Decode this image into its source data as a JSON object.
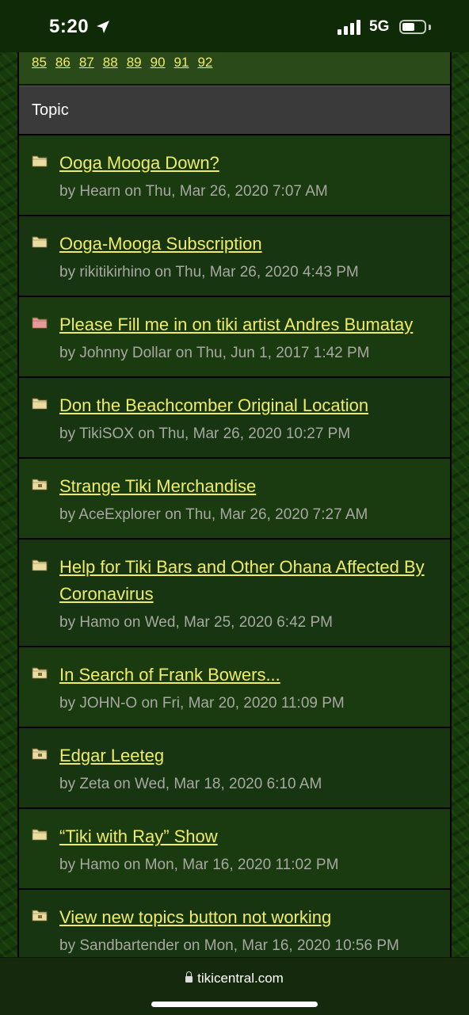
{
  "status": {
    "time": "5:20",
    "network": "5G"
  },
  "pagination": {
    "pages": [
      "85",
      "86",
      "87",
      "88",
      "89",
      "90",
      "91",
      "92"
    ]
  },
  "table": {
    "header": "Topic"
  },
  "topics": [
    {
      "title": "Ooga Mooga Down?",
      "meta": "by Hearn on Thu, Mar 26, 2020 7:07 AM",
      "icon": "folder-icon",
      "icon_color": "#e8dca0"
    },
    {
      "title": "Ooga-Mooga Subscription",
      "meta": "by rikitikirhino on Thu, Mar 26, 2020 4:43 PM",
      "icon": "folder-icon",
      "icon_color": "#e8dca0"
    },
    {
      "title": "Please Fill me in on tiki artist Andres Bumatay",
      "meta": "by Johnny Dollar on Thu, Jun 1, 2017 1:42 PM",
      "icon": "folder-hot-icon",
      "icon_color": "#e89a9a"
    },
    {
      "title": "Don the Beachcomber Original Location",
      "meta": "by TikiSOX on Thu, Mar 26, 2020 10:27 PM",
      "icon": "folder-icon",
      "icon_color": "#e8dca0"
    },
    {
      "title": "Strange Tiki Merchandise",
      "meta": "by AceExplorer on Thu, Mar 26, 2020 7:27 AM",
      "icon": "folder-posted-icon",
      "icon_color": "#e8dca0"
    },
    {
      "title": "Help for Tiki Bars and Other Ohana Affected By Coronavirus",
      "meta": "by Hamo on Wed, Mar 25, 2020 6:42 PM",
      "icon": "folder-icon",
      "icon_color": "#e8dca0"
    },
    {
      "title": "In Search of Frank Bowers...",
      "meta": "by JOHN-O on Fri, Mar 20, 2020 11:09 PM",
      "icon": "folder-posted-icon",
      "icon_color": "#e8dca0"
    },
    {
      "title": "Edgar Leeteg",
      "meta": "by Zeta on Wed, Mar 18, 2020 6:10 AM",
      "icon": "folder-posted-icon",
      "icon_color": "#e8dca0"
    },
    {
      "title": "“Tiki with Ray” Show",
      "meta": "by Hamo on Mon, Mar 16, 2020 11:02 PM",
      "icon": "folder-icon",
      "icon_color": "#e8dca0"
    },
    {
      "title": "View new topics button not working",
      "meta": "by Sandbartender on Mon, Mar 16, 2020 10:56 PM",
      "icon": "folder-posted-icon",
      "icon_color": "#e8dca0"
    }
  ],
  "browser": {
    "url": "tikicentral.com"
  }
}
